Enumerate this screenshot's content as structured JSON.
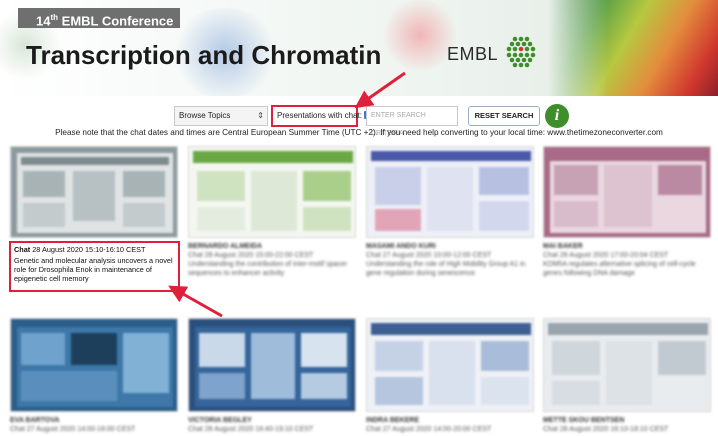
{
  "header": {
    "conference_label": "14",
    "conference_sup": "th",
    "conference_rest": " EMBL Conference",
    "title": "Transcription and Chromatin",
    "logo_text": "EMBL"
  },
  "toolbar": {
    "topics_select": "Browse Topics",
    "chat_filter_label": "Presentations with chat:",
    "chat_filter_checked": true,
    "search_placeholder": "ENTER SEARCH CRITERIA",
    "reset_label": "RESET SEARCH",
    "info_label": "i"
  },
  "notice": "Please note that the chat dates and times are Central European Summer Time (UTC +2). If you need help converting to your local time: www.thetimezoneconverter.com",
  "highlighted_card": {
    "chat_word": "Chat",
    "chat_time": " 28 August 2020 15:10-16:10 CEST",
    "description": "Genetic and molecular analysis uncovers a novel role for Drosophila Enok in maintenance of epigenetic cell memory"
  },
  "cards_row1": [
    {
      "presenter": "BERNARDO ALMEIDA",
      "chat": "Chat 28 August 2020 15:00-22:00 CEST",
      "title": "Understanding the contribution of inter-motif spacer sequences to enhancer activity"
    },
    {
      "presenter": "MASAMI ANDO KURI",
      "chat": "Chat 27 August 2020 10:00-12:00 CEST",
      "title": "Understanding the role of High Mobility Group A1 in gene regulation during senescence"
    },
    {
      "presenter": "MAI BAKER",
      "chat": "Chat 28 August 2020 17:00-20:04 CEST",
      "title": "KDM5A regulates alternative splicing of cell-cycle genes following DNA damage"
    }
  ],
  "cards_row2": [
    {
      "presenter": "EVA BARTOVA",
      "chat": "Chat 27 August 2020 14:00-16:00 CEST"
    },
    {
      "presenter": "VICTORIA BEGLEY",
      "chat": "Chat 28 August 2020 16:40-19:10 CEST"
    },
    {
      "presenter": "INDRA BEKERE",
      "chat": "Chat 27 August 2020 14:00-20:00 CEST"
    },
    {
      "presenter": "METTE SKOU BENTSEN",
      "chat": "Chat 28 August 2020 16:10-18:10 CEST"
    }
  ],
  "colors": {
    "highlight_red": "#e0203b",
    "info_green": "#3e8f2b",
    "checkbox_blue": "#3b79d8"
  },
  "icons": {
    "info": "info-icon",
    "select_chevron": "chevron-updown-icon",
    "logo": "embl-hexagon-logo"
  }
}
